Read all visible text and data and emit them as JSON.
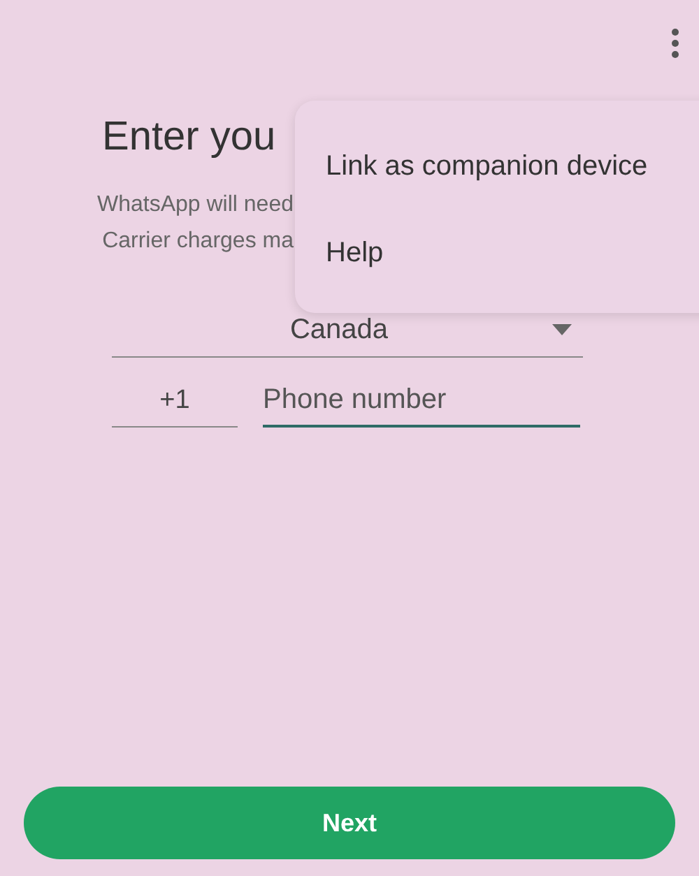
{
  "toolbar": {
    "menu_open": true
  },
  "title": "Enter you",
  "subtitle_lines": [
    "WhatsApp will need",
    "Carrier charges ma"
  ],
  "menu": {
    "items": [
      {
        "label": "Link as companion device"
      },
      {
        "label": "Help"
      }
    ]
  },
  "country": {
    "value": "Canada"
  },
  "phone": {
    "country_code": "+1",
    "placeholder": "Phone number",
    "focused": true
  },
  "next_button": "Next"
}
